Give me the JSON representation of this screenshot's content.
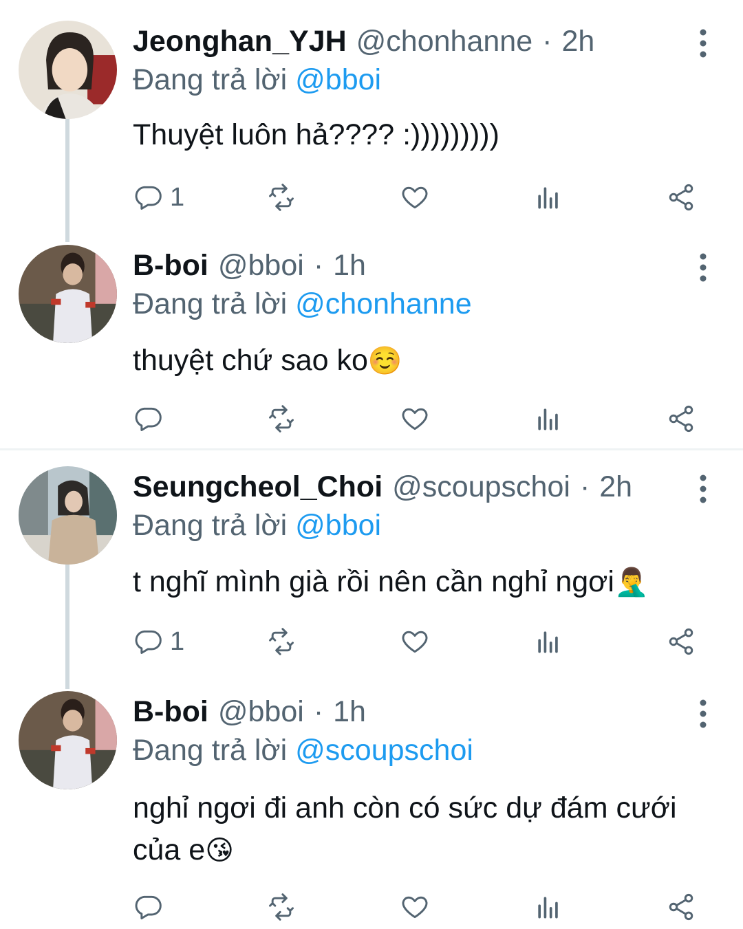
{
  "colors": {
    "accent": "#1d9bf0",
    "secondary_text": "#536471",
    "primary_text": "#0f1419",
    "thread_line": "#cfd9de"
  },
  "replying_prefix": "Đang trả lời",
  "tweets": [
    {
      "name": "Jeonghan_YJH",
      "handle": "@chonhanne",
      "sep": "·",
      "time": "2h",
      "replying_to": "@bboi",
      "text": "Thuyệt luôn hả???? :)))))))))",
      "emoji": "",
      "text2": "",
      "reply_count": "1"
    },
    {
      "name": "B-boi",
      "handle": "@bboi",
      "sep": "·",
      "time": "1h",
      "replying_to": "@chonhanne",
      "text": "thuyệt chứ sao ko",
      "emoji": "☺️",
      "text2": "",
      "reply_count": ""
    },
    {
      "name": "Seungcheol_Choi",
      "handle": "@scoupschoi",
      "sep": "·",
      "time": "2h",
      "replying_to": "@bboi",
      "text": "t nghĩ mình già rồi nên cần nghỉ ngơi",
      "emoji": "🤦‍♂️",
      "text2": "",
      "reply_count": "1"
    },
    {
      "name": "B-boi",
      "handle": "@bboi",
      "sep": "·",
      "time": "1h",
      "replying_to": "@scoupschoi",
      "text": "nghỉ ngơi đi anh còn có sức dự đám cưới",
      "emoji": "",
      "text2": "của e",
      "emoji2": "😘",
      "reply_count": ""
    }
  ],
  "icons": {
    "reply": "reply-icon",
    "retweet": "retweet-icon",
    "like": "heart-icon",
    "views": "analytics-icon",
    "share": "share-icon",
    "more": "more-vertical-icon"
  }
}
